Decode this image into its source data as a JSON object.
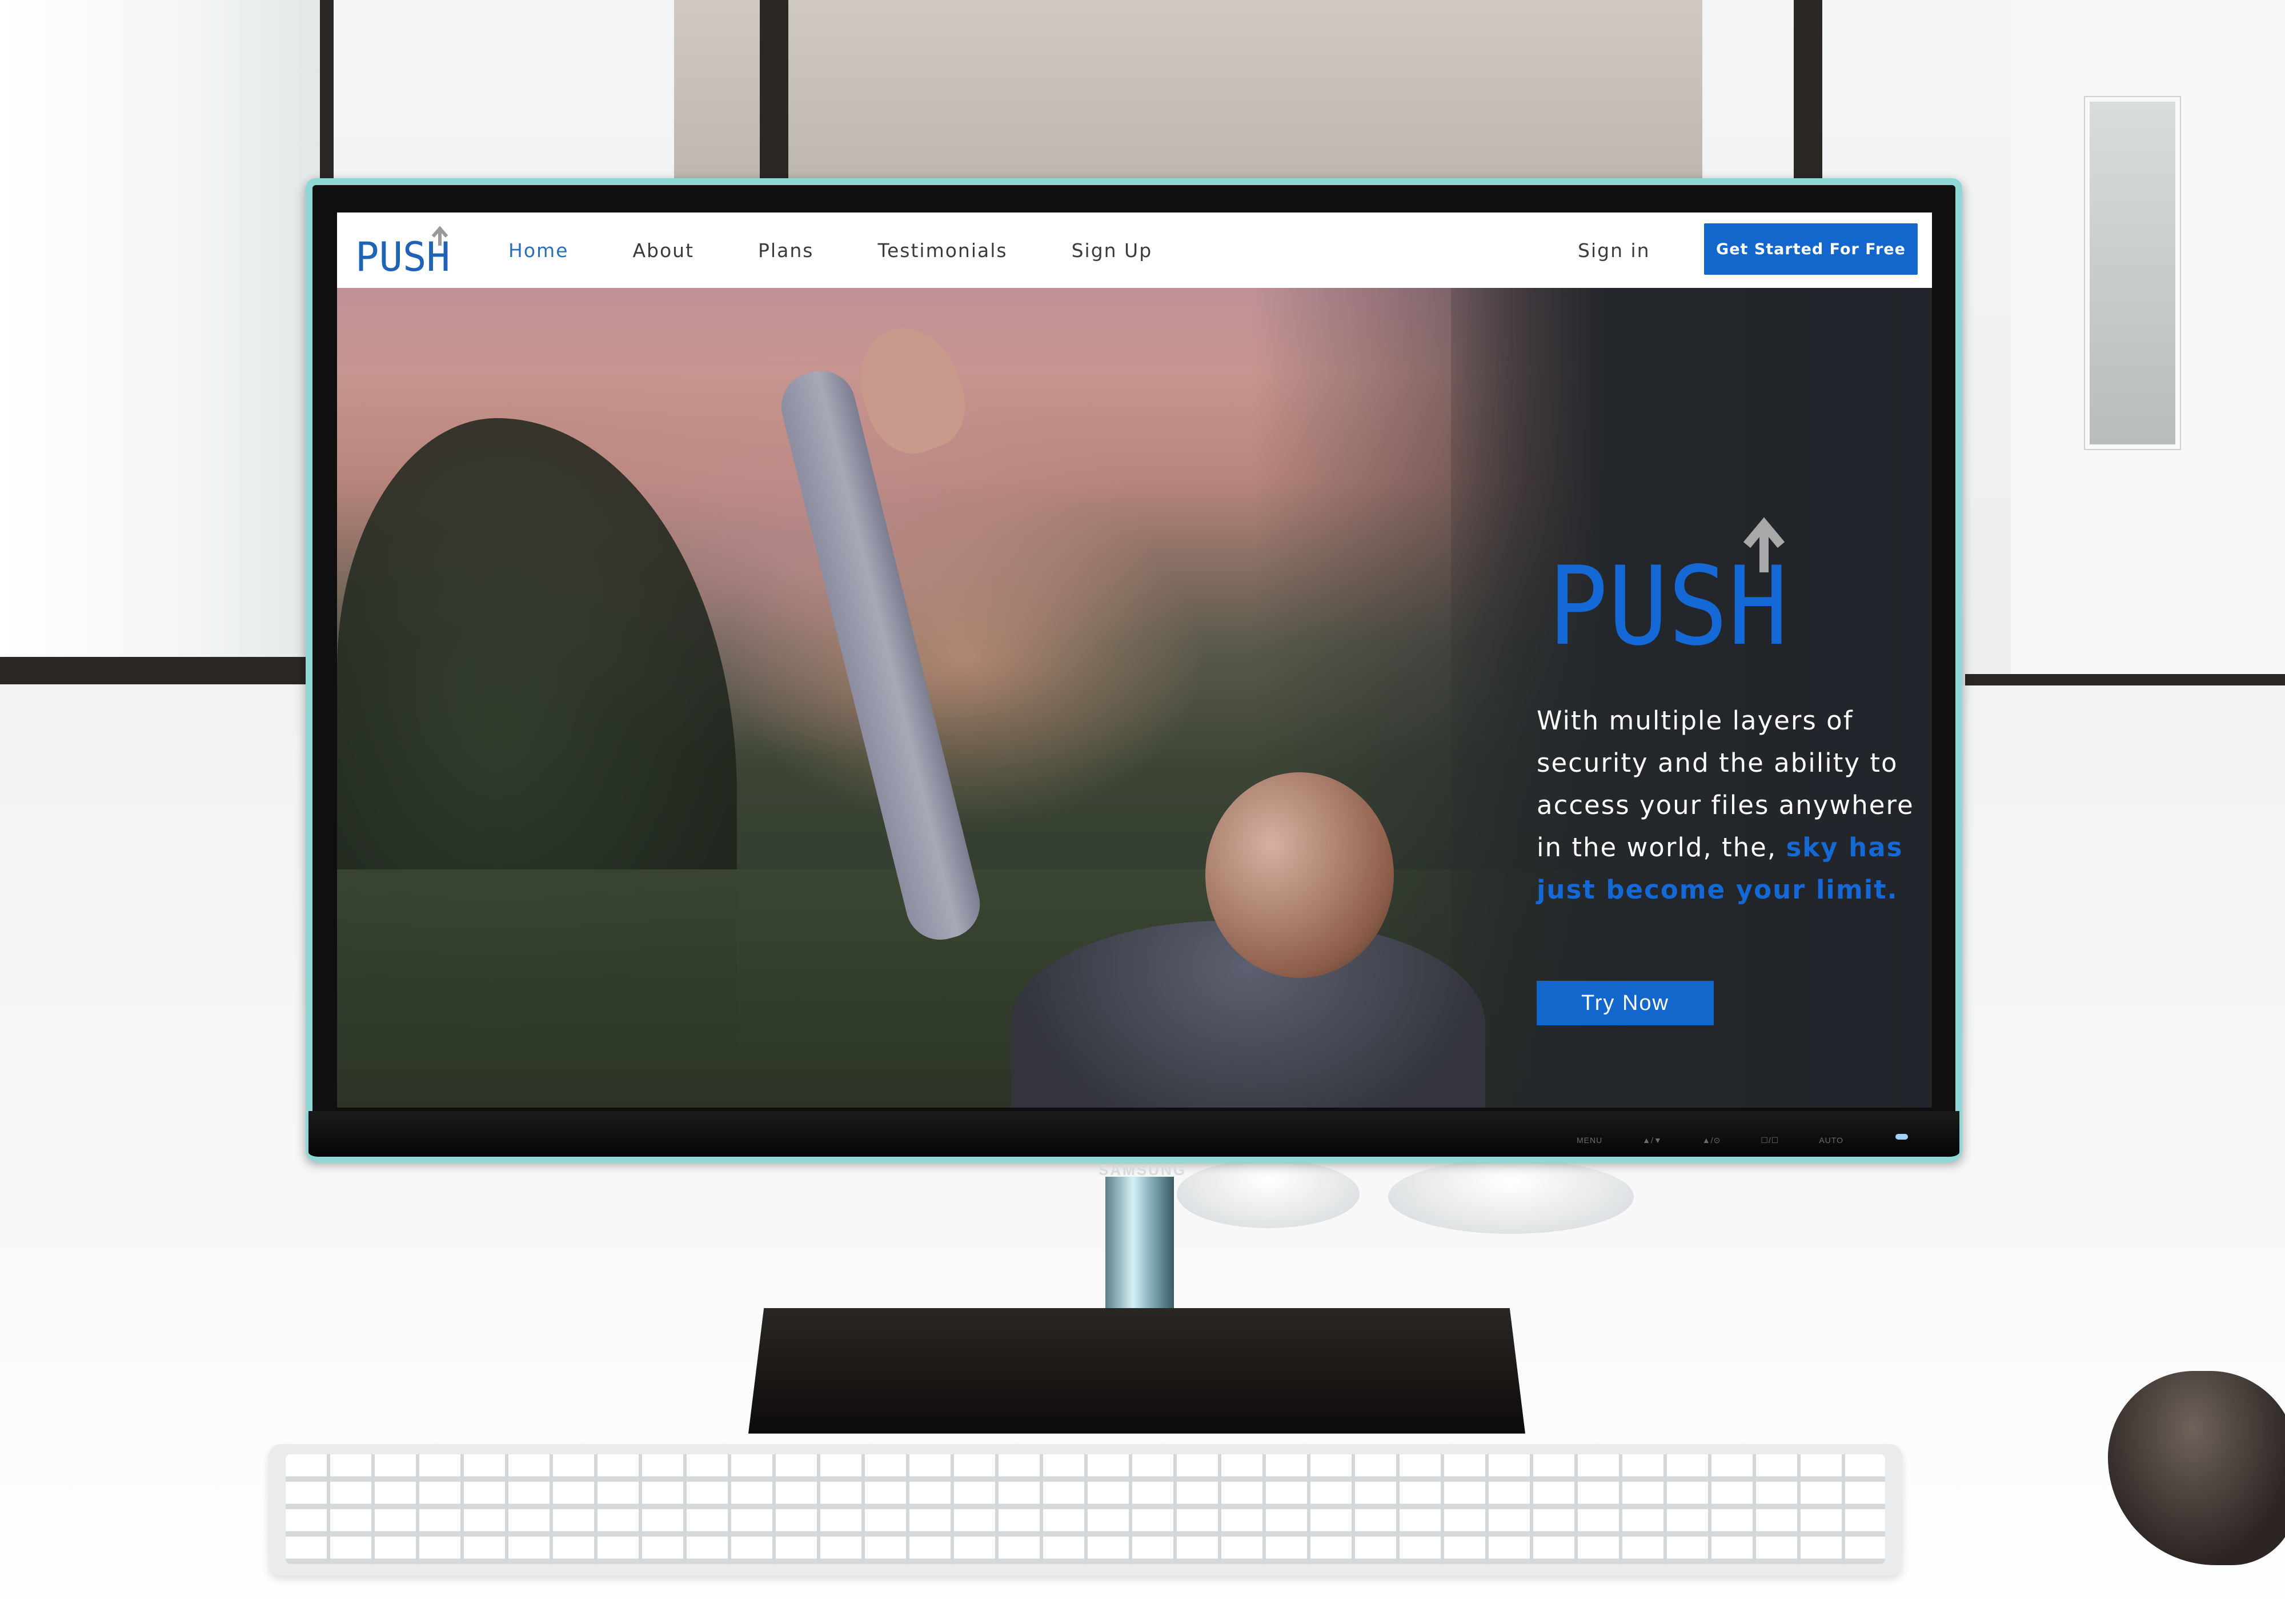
{
  "site": {
    "logo_text": "PUSH",
    "brand_color": "#1266cc"
  },
  "navbar": {
    "items": [
      {
        "label": "Home",
        "active": true
      },
      {
        "label": "About",
        "active": false
      },
      {
        "label": "Plans",
        "active": false
      },
      {
        "label": "Testimonials",
        "active": false
      },
      {
        "label": "Sign Up",
        "active": false
      }
    ],
    "signin_label": "Sign in",
    "cta_label": "Get Started For Free"
  },
  "hero": {
    "logo_text": "PUSH",
    "text_plain": "With multiple layers of security and the ability to access your files anywhere in the world, the, ",
    "text_accent": "sky has just become your limit.",
    "button_label": "Try Now"
  },
  "monitor": {
    "brand": "SAMSUNG",
    "osd_labels": [
      "MENU",
      "▲/▼",
      "▲/⊙",
      "☐/☐",
      "AUTO"
    ]
  }
}
